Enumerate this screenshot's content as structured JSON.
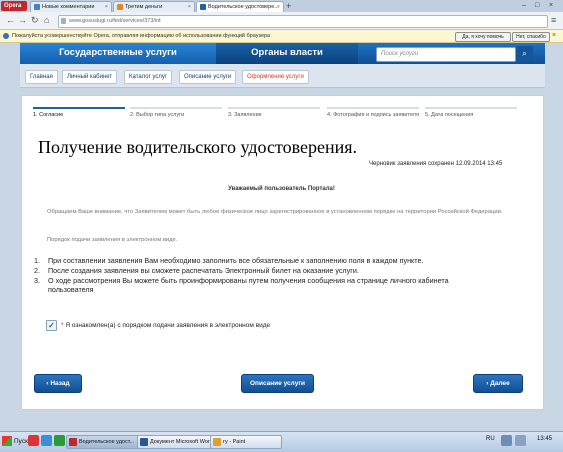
{
  "browser": {
    "opera_label": "Opera",
    "tabs": [
      {
        "label": "Новые комментарии",
        "color": "#4a7fc1"
      },
      {
        "label": "Третим деньги",
        "color": "#e08a1e"
      },
      {
        "label": "Водительское удостовере...",
        "color": "#1f5fa8"
      }
    ],
    "new_tab": "+",
    "url": "www.gosuslugi.ru/fed/services/373/int",
    "infobar_text": "Пожалуйста усовершенствуйте Opera, отправляя информацию об использовании функций браузера",
    "infobar_yes": "Да, я хочу помочь",
    "infobar_no": "Нет, спасибо"
  },
  "site": {
    "nav": [
      "Государственные услуги",
      "Органы власти"
    ],
    "search_placeholder": "Поиск услуги",
    "breadcrumbs": [
      "Главная",
      "Личный кабинет",
      "Каталог услуг",
      "Описание услуги",
      "Оформление услуги"
    ]
  },
  "wizard": {
    "steps": [
      "1. Согласие",
      "2. Выбор типа услуги",
      "3. Заявление",
      "4. Фотография и подпись заявителя",
      "5. Дата посещения"
    ]
  },
  "content": {
    "title": "Получение водительского удостоверения.",
    "draft": "Черновик заявления сохранен 12.09.2014 13:45",
    "greeting": "Уважаемый пользователь Портала!",
    "notice": "Обращаем Ваше внимание, что Заявителем может быть любое физическое лицо зарегистрированное в установленном порядке на территории Российской Федерации.",
    "order_label": "Порядок подачи заявления в электронном виде.",
    "items": [
      "При составлении заявления Вам необходимо заполнить все обязательные к заполнению поля в каждом пункте.",
      "После создания заявления вы сможете распечатать Электронный билет на оказание услуги.",
      "О ходе рассмотрения Вы можете быть проинформированы путем получения сообщения на странице личного кабинета пользователя"
    ],
    "checkbox_label": "Я ознакомлен(а) с порядком подачи заявления в электронном виде",
    "btn_back": "Назад",
    "btn_desc": "Описание услуги",
    "btn_next": "Далее"
  },
  "taskbar": {
    "start": "Пуск",
    "tasks": [
      "Водительское удост...",
      "Документ Microsoft Wor...",
      "гу - Paint"
    ],
    "lang": "RU",
    "time": "13:45"
  }
}
